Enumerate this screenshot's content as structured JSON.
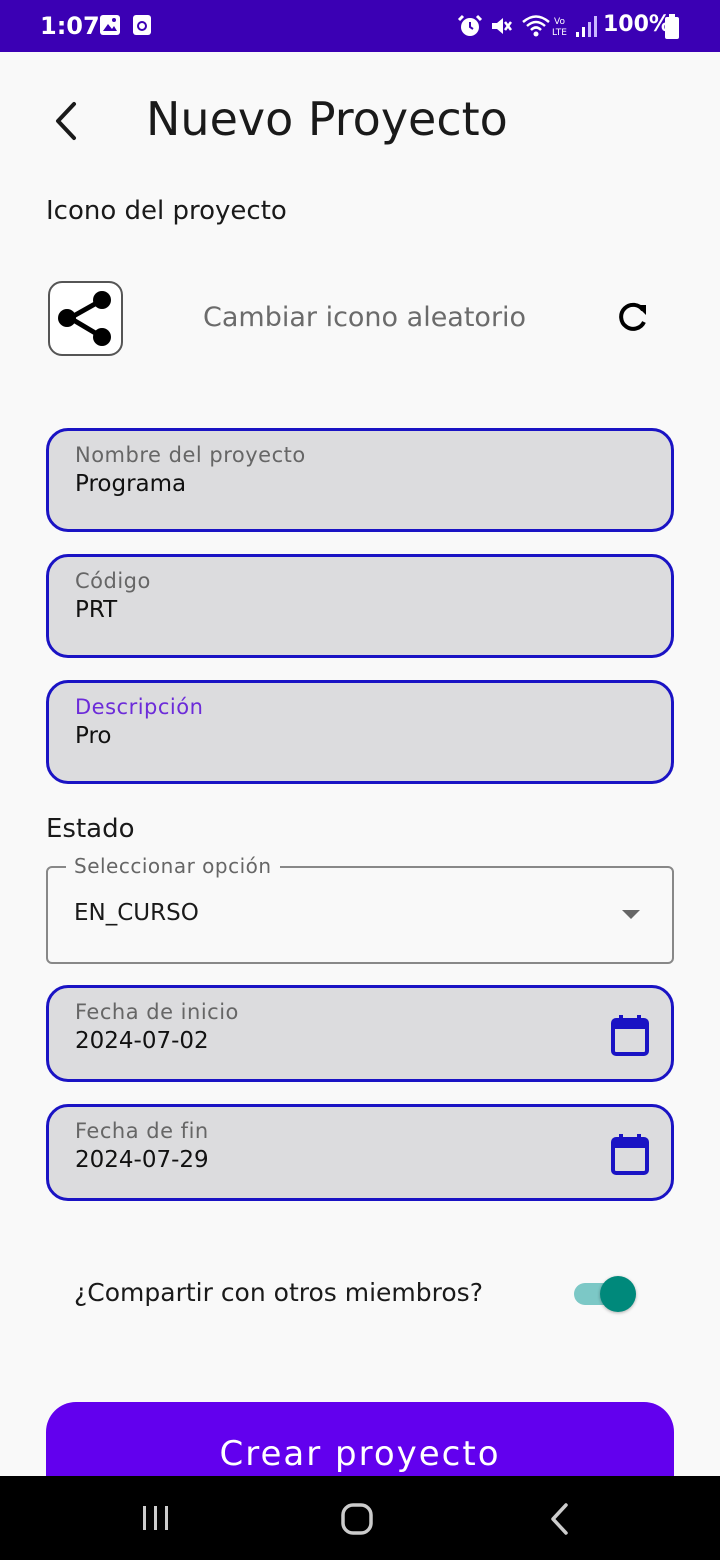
{
  "status_bar": {
    "time": "1:07",
    "battery": "100%",
    "left_icons": [
      "image-icon",
      "cast-icon"
    ],
    "right_icons": [
      "alarm-icon",
      "mute-icon",
      "wifi-icon",
      "volte-icon",
      "signal-icon",
      "battery-icon"
    ],
    "color": "#3b00b4"
  },
  "header": {
    "title": "Nuevo Proyecto",
    "back_icon": "back-arrow-icon"
  },
  "icon_section": {
    "label": "Icono del proyecto",
    "current_icon": "share-icon",
    "change_text": "Cambiar icono aleatorio",
    "refresh_icon": "refresh-icon"
  },
  "form": {
    "name": {
      "label": "Nombre del proyecto",
      "value": "Programa"
    },
    "code": {
      "label": "Código",
      "value": "PRT"
    },
    "description": {
      "label": "Descripción",
      "value": "Pro"
    },
    "status": {
      "label": "Estado",
      "legend": "Seleccionar opción",
      "value": "EN_CURSO"
    },
    "start_date": {
      "label": "Fecha de inicio",
      "value": "2024-07-02",
      "icon": "calendar-icon"
    },
    "end_date": {
      "label": "Fecha de fin",
      "value": "2024-07-29",
      "icon": "calendar-icon"
    },
    "share": {
      "label": "¿Compartir con otros miembros?",
      "enabled": true
    }
  },
  "actions": {
    "create_label": "Crear proyecto",
    "color": "#6200ee"
  },
  "colors": {
    "field_border": "#1a13c4",
    "accent_focus": "#6c2bd9",
    "toggle": "#00897b"
  },
  "nav_bar": {
    "buttons": [
      "recents-icon",
      "home-icon",
      "back-nav-icon"
    ]
  }
}
